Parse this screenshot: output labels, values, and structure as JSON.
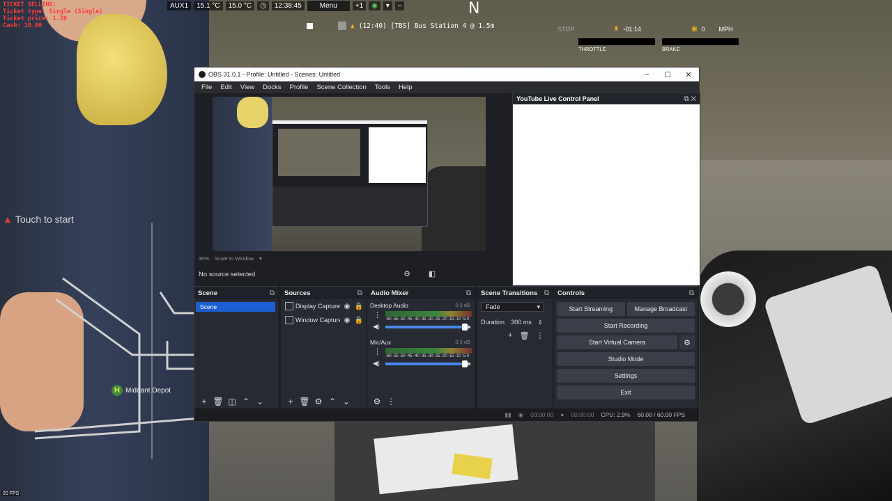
{
  "game": {
    "ticket_lines": [
      "TICKET SELLING:",
      "Ticket type: Single (Single)",
      "Ticket price: 1.30",
      "Cash: 10.00"
    ],
    "topbar": {
      "aux": "AUX1",
      "temp_outside": "15.1 °C",
      "temp_inside": "15.0 °C",
      "time": "12:38:45",
      "menu": "Menu",
      "counter": "+1",
      "minus": "–"
    },
    "compass": "N",
    "route_text": "(12:40) [TBS] Bus Station 4 @ 1.5m",
    "hud": {
      "stop": "STOP",
      "delay": "-01:14",
      "speed_value": "0",
      "speed_unit": "MPH",
      "throttle": "THROTTLE",
      "brake": "BRAKE"
    },
    "touch_to_start": "Touch to start",
    "depot": "Middant Depot",
    "depot_badge": "H",
    "fps": "20 FPS"
  },
  "obs": {
    "title": "OBS 31.0.1 - Profile: Untitled - Scenes: Untitled",
    "menu": [
      "File",
      "Edit",
      "View",
      "Docks",
      "Profile",
      "Scene Collection",
      "Tools",
      "Help"
    ],
    "preview_zoom": "30%",
    "preview_scale": "Scale to Window",
    "no_source": "No source selected",
    "youtube_panel": "YouTube Live Control Panel",
    "docks": {
      "scenes": {
        "title": "Scene",
        "items": [
          "Scene"
        ]
      },
      "sources": {
        "title": "Sources",
        "items": [
          "Display Capture",
          "Window Capture"
        ]
      },
      "mixer": {
        "title": "Audio Mixer",
        "channels": [
          {
            "name": "Desktop Audio",
            "db": "0.0 dB",
            "volume_fraction": 0.95
          },
          {
            "name": "Mic/Aux",
            "db": "0.0 dB",
            "volume_fraction": 0.95
          }
        ],
        "ticks": "-60 -55 -50 -45 -40 -35 -30 -25 -20 -15 -10 -5 0"
      },
      "transitions": {
        "title": "Scene Transitions",
        "selected": "Fade",
        "duration_label": "Duration",
        "duration_value": "300 ms"
      },
      "controls": {
        "title": "Controls",
        "start_streaming": "Start Streaming",
        "manage_broadcast": "Manage Broadcast",
        "start_recording": "Start Recording",
        "start_virtual_camera": "Start Virtual Camera",
        "studio_mode": "Studio Mode",
        "settings": "Settings",
        "exit": "Exit"
      }
    },
    "status": {
      "stream_time": "00:00:00",
      "rec_time": "00:00:00",
      "cpu": "CPU: 2.9%",
      "fps": "60.00 / 60.00 FPS"
    }
  }
}
